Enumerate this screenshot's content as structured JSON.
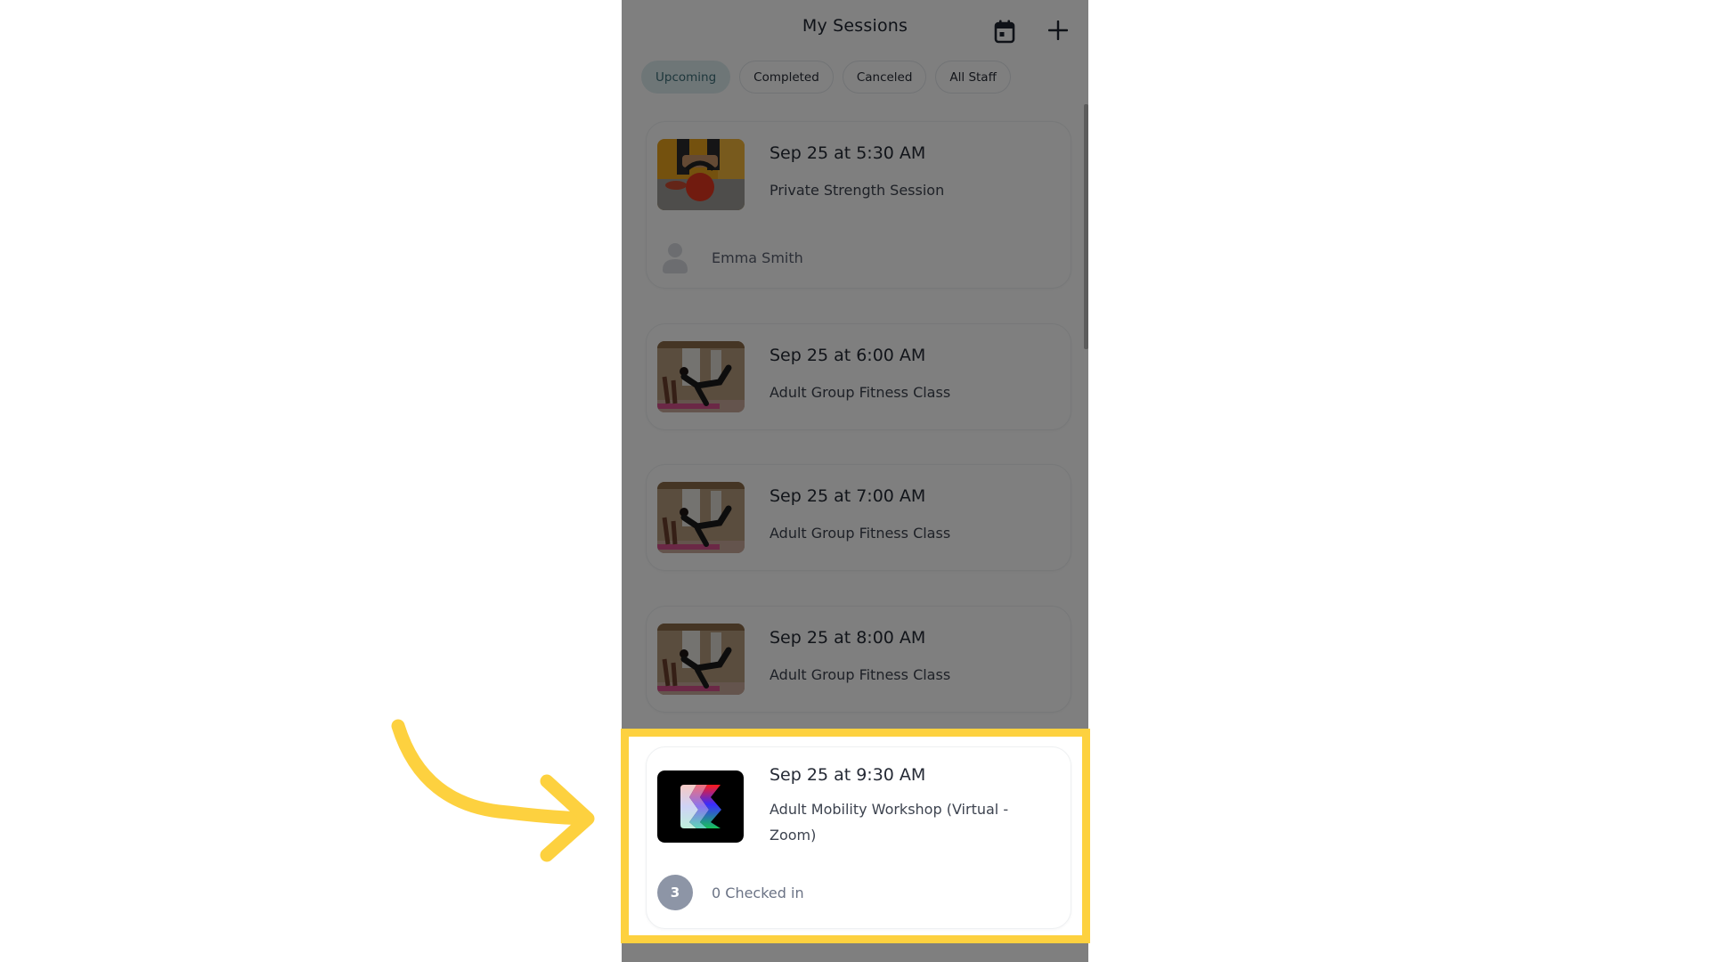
{
  "header": {
    "title": "My Sessions",
    "calendar_icon": "calendar-icon",
    "add_icon": "plus-icon"
  },
  "filters": [
    {
      "label": "Upcoming",
      "active": true
    },
    {
      "label": "Completed",
      "active": false
    },
    {
      "label": "Canceled",
      "active": false
    },
    {
      "label": "All Staff",
      "active": false
    }
  ],
  "sessions": [
    {
      "date": "Sep 25 at 5:30 AM",
      "title": "Private Strength Session",
      "thumbnail": "kettlebell-photo",
      "footer": {
        "type": "client",
        "icon": "person-icon",
        "text": "Emma Smith"
      }
    },
    {
      "date": "Sep 25 at 6:00 AM",
      "title": "Adult Group Fitness Class",
      "thumbnail": "group-fitness-photo"
    },
    {
      "date": "Sep 25 at 7:00 AM",
      "title": "Adult Group Fitness Class",
      "thumbnail": "group-fitness-photo"
    },
    {
      "date": "Sep 25 at 8:00 AM",
      "title": "Adult Group Fitness Class",
      "thumbnail": "group-fitness-photo"
    },
    {
      "date": "Sep 25 at 9:30 AM",
      "title": "Adult Mobility Workshop (Virtual - Zoom)",
      "thumbnail": "workshop-logo",
      "footer": {
        "type": "attendance",
        "badge": "3",
        "text": "0 Checked in"
      }
    }
  ],
  "annotation": {
    "highlight_color": "#fdd13f",
    "arrow_color": "#fdd13f",
    "highlighted_session_index": 4
  },
  "colors": {
    "overlay": "rgba(0,0,0,0.5)",
    "chip_active_bg": "#dcecef",
    "chip_active_text": "#3d6f78",
    "badge_bg": "#8d95a6"
  }
}
